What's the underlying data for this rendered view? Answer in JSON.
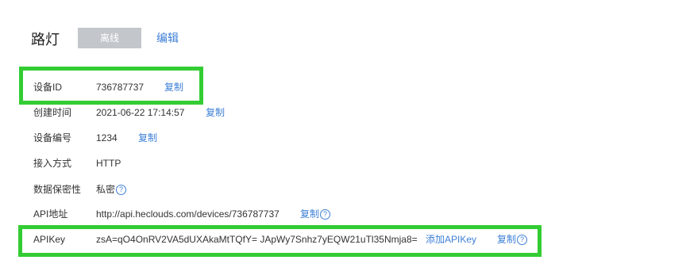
{
  "header": {
    "title": "路灯",
    "status_label": "离线",
    "edit_label": "编辑"
  },
  "rows": [
    {
      "label": "设备ID",
      "value": "736787737",
      "action": "复制"
    },
    {
      "label": "创建时间",
      "value": "2021-06-22 17:14:57",
      "action": "复制"
    },
    {
      "label": "设备编号",
      "value": "1234",
      "action": "复制"
    },
    {
      "label": "接入方式",
      "value": "HTTP"
    },
    {
      "label": "数据保密性",
      "value": "私密",
      "help_icon": "?"
    },
    {
      "label": "API地址",
      "value": "http://api.heclouds.com/devices/736787737",
      "action": "复制",
      "help_icon": "?"
    },
    {
      "label": "APIKey",
      "value": "zsA=qO4OnRV2VA5dUXAkaMtTQfY=  JApWy7Snhz7yEQW21uTl35Nmja8=",
      "add_action": "添加APIKey",
      "action": "复制",
      "help_icon": "?"
    }
  ],
  "colors": {
    "link": "#3d7fd6",
    "status_badge": "#c3c7cc",
    "highlight": "#33cc33"
  }
}
